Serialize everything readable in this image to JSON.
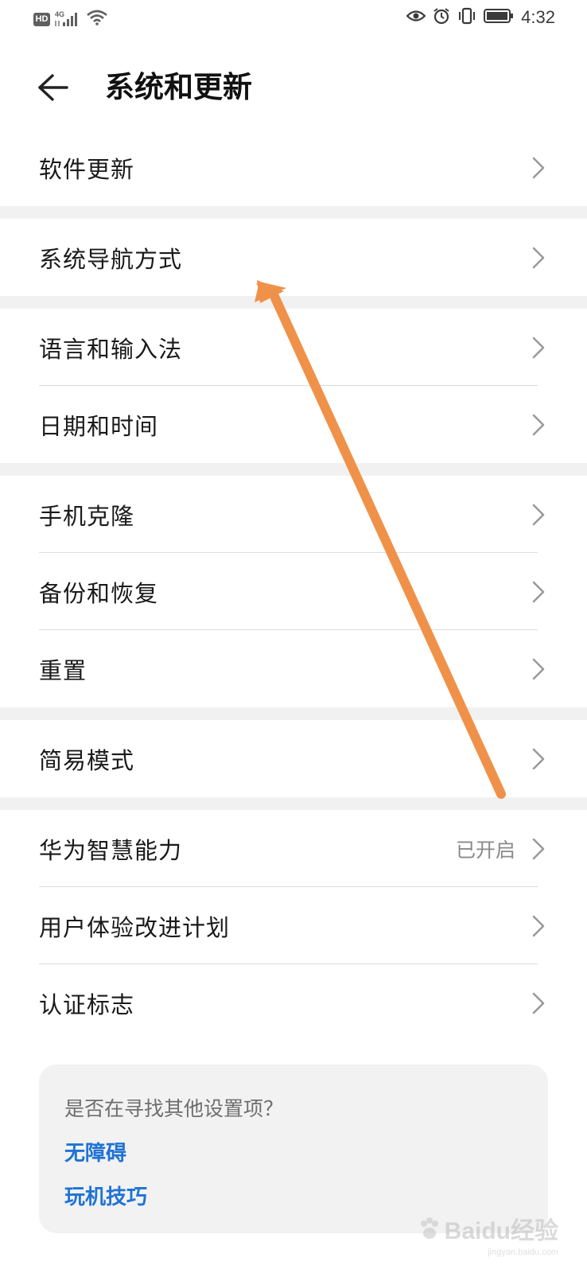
{
  "status_bar": {
    "hd_badge": "HD",
    "network_type": "4G",
    "time": "4:32",
    "icons": [
      "hd-icon",
      "signal-icon",
      "wifi-icon",
      "eye-icon",
      "alarm-icon",
      "vibrate-icon",
      "battery-icon"
    ]
  },
  "header": {
    "title": "系统和更新",
    "back_icon": "back-arrow-icon"
  },
  "groups": [
    {
      "items": [
        {
          "label": "软件更新"
        }
      ]
    },
    {
      "items": [
        {
          "label": "系统导航方式"
        }
      ]
    },
    {
      "items": [
        {
          "label": "语言和输入法"
        },
        {
          "label": "日期和时间"
        }
      ]
    },
    {
      "items": [
        {
          "label": "手机克隆"
        },
        {
          "label": "备份和恢复"
        },
        {
          "label": "重置"
        }
      ]
    },
    {
      "items": [
        {
          "label": "简易模式"
        }
      ]
    },
    {
      "items": [
        {
          "label": "华为智慧能力",
          "value": "已开启"
        },
        {
          "label": "用户体验改进计划"
        },
        {
          "label": "认证标志"
        }
      ]
    }
  ],
  "suggestion": {
    "question": "是否在寻找其他设置项？",
    "links": [
      "无障碍",
      "玩机技巧"
    ]
  },
  "watermark": {
    "text": "Baidu经验",
    "sub": "jingyan.baidu.com"
  },
  "colors": {
    "annotation_arrow": "#F0914A",
    "link": "#1F73D4",
    "group_gap": "#F1F1F1"
  }
}
